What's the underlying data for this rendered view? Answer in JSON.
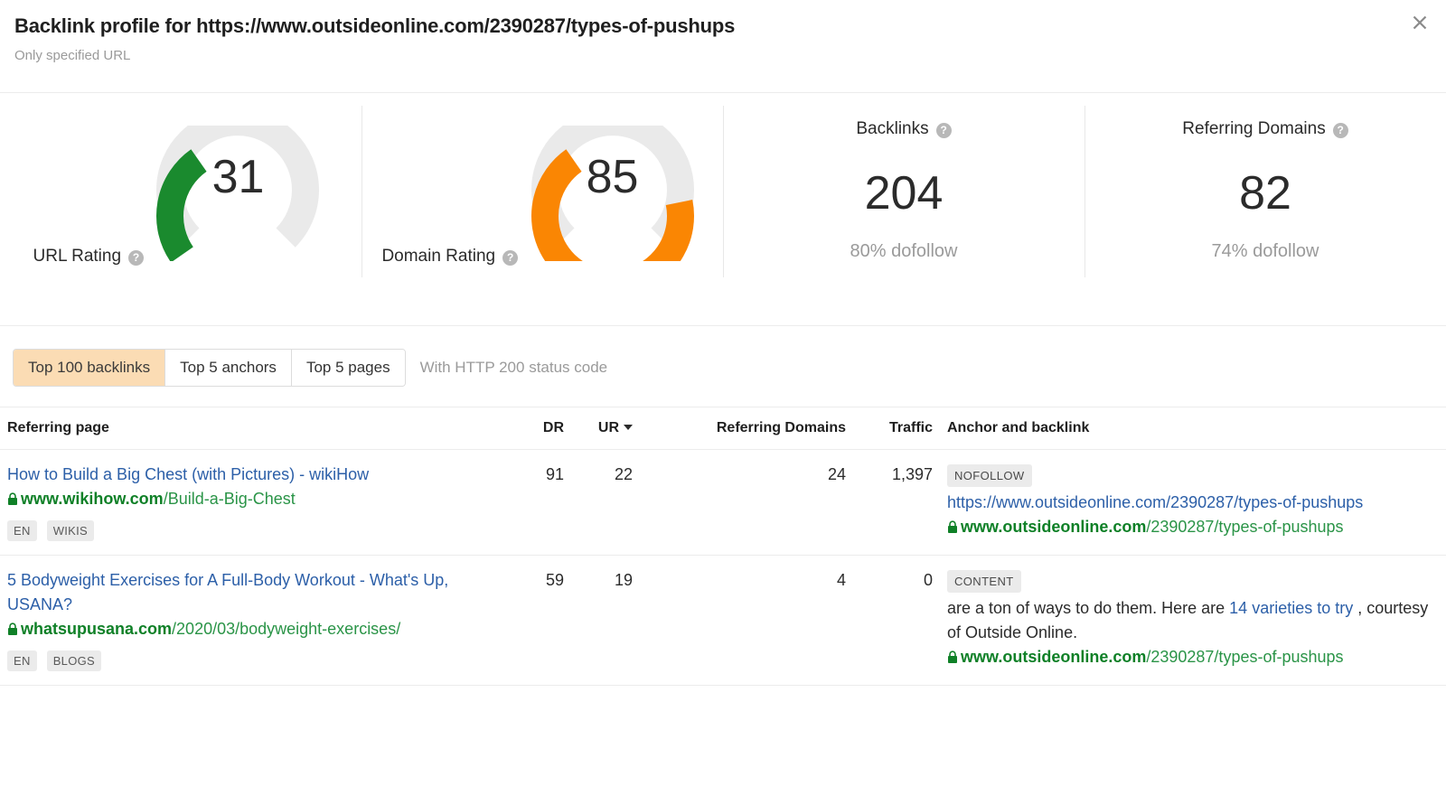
{
  "header": {
    "title": "Backlink profile for https://www.outsideonline.com/2390287/types-of-pushups",
    "subtitle": "Only specified URL",
    "close_label": "✕"
  },
  "metrics": [
    {
      "label": "URL Rating",
      "help": "?",
      "value": "31",
      "percent": 31,
      "color": "#1a8a2e",
      "type": "gauge",
      "sub": ""
    },
    {
      "label": "Domain Rating",
      "help": "?",
      "value": "85",
      "percent": 85,
      "color": "#fa8603",
      "type": "gauge",
      "sub": ""
    },
    {
      "label": "Backlinks",
      "help": "?",
      "value": "204",
      "type": "plain",
      "sub": "80% dofollow"
    },
    {
      "label": "Referring Domains",
      "help": "?",
      "value": "82",
      "type": "plain",
      "sub": "74% dofollow"
    }
  ],
  "tabs": [
    {
      "label": "Top 100 backlinks",
      "active": true
    },
    {
      "label": "Top 5 anchors",
      "active": false
    },
    {
      "label": "Top 5 pages",
      "active": false
    }
  ],
  "tab_note": "With HTTP 200 status code",
  "table": {
    "columns": {
      "page": "Referring page",
      "dr": "DR",
      "ur": "UR",
      "rd": "Referring Domains",
      "traffic": "Traffic",
      "anchor": "Anchor and backlink"
    },
    "sort": {
      "column": "UR",
      "direction": "desc"
    },
    "rows": [
      {
        "page_title": "How to Build a Big Chest (with Pictures) - wikiHow",
        "domain": "www.wikihow.com",
        "path": "/Build-a-Big-Chest",
        "badges": [
          "EN",
          "WIKIS"
        ],
        "dr": "91",
        "ur": "22",
        "rd": "24",
        "traffic": "1,397",
        "anchor_tag": "NOFOLLOW",
        "anchor_url": "https://www.outsideonline.com/2390287/types-of-pushups",
        "anchor_text_before": "",
        "anchor_text_link": "",
        "anchor_text_after": "",
        "target_domain": "www.outsideonline.com",
        "target_path": "/2390287/types-of-pushups"
      },
      {
        "page_title": "5 Bodyweight Exercises for A Full-Body Workout - What's Up, USANA?",
        "domain": "whatsupusana.com",
        "path": "/2020/03/bodyweight-exercises/",
        "badges": [
          "EN",
          "BLOGS"
        ],
        "dr": "59",
        "ur": "19",
        "rd": "4",
        "traffic": "0",
        "anchor_tag": "CONTENT",
        "anchor_url": "",
        "anchor_text_before": "are a ton of ways to do them. Here are ",
        "anchor_text_link": "14 varieties to try",
        "anchor_text_after": " , courtesy of Outside Online.",
        "target_domain": "www.outsideonline.com",
        "target_path": "/2390287/types-of-pushups"
      }
    ]
  }
}
